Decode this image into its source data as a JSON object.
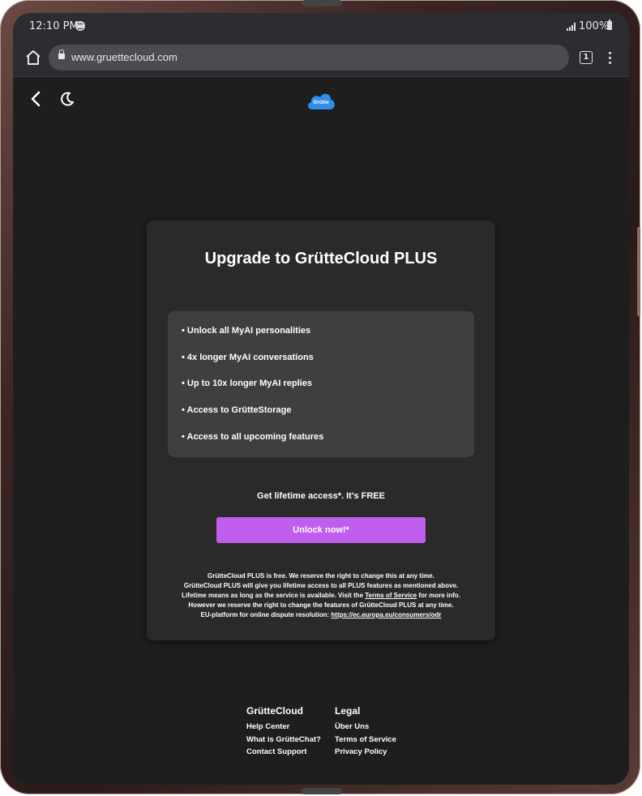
{
  "status_bar": {
    "time": "12:10 PM",
    "battery": "100%",
    "icons": [
      "spotify-icon",
      "signal-icon",
      "battery-icon"
    ]
  },
  "browser": {
    "url": "www.gruettecloud.com",
    "tab_count": "1",
    "icons": [
      "home-icon",
      "lock-icon",
      "menu-dots-icon"
    ]
  },
  "header": {
    "logo_text": "Grütte",
    "icons": [
      "back-icon",
      "moon-icon",
      "cloud-logo-icon"
    ]
  },
  "upgrade_card": {
    "title": "Upgrade to GrütteCloud PLUS",
    "features": [
      "• Unlock all MyAI personalities",
      "• 4x longer MyAI conversations",
      "• Up to 10x longer MyAI replies",
      "• Access to GrütteStorage",
      "• Access to all upcoming features"
    ],
    "lifetime_text": "Get lifetime access*. It's FREE",
    "button_label": "Unlock now!*",
    "disclaimer": {
      "line1": "GrütteCloud PLUS is free. We reserve the right to change this at any time.",
      "line2": "GrütteCloud PLUS will give you lifetime access to all PLUS features as mentioned above.",
      "line3_before": "Lifetime means as long as the service is available. Visit the ",
      "line3_link": "Terms of Service",
      "line3_after": " for more info.",
      "line4": "However we reserve the right to change the features of GrütteCloud PLUS at any time.",
      "line5_before": "EU-platform for online dispute resolution: ",
      "line5_link": "https://ec.europa.eu/consumers/odr"
    }
  },
  "footer": {
    "brand": {
      "heading": "GrütteCloud",
      "links": [
        "Help Center",
        "What is GrütteChat?",
        "Contact Support"
      ]
    },
    "legal": {
      "heading": "Legal",
      "links": [
        "Über Uns",
        "Terms of Service",
        "Privacy Policy"
      ]
    }
  },
  "colors": {
    "background": "#1e1e1e",
    "card": "#2a2a2a",
    "feature_box": "#3f3f3f",
    "accent_button": "#bf5ded",
    "browser_chrome": "#2b2d30"
  }
}
